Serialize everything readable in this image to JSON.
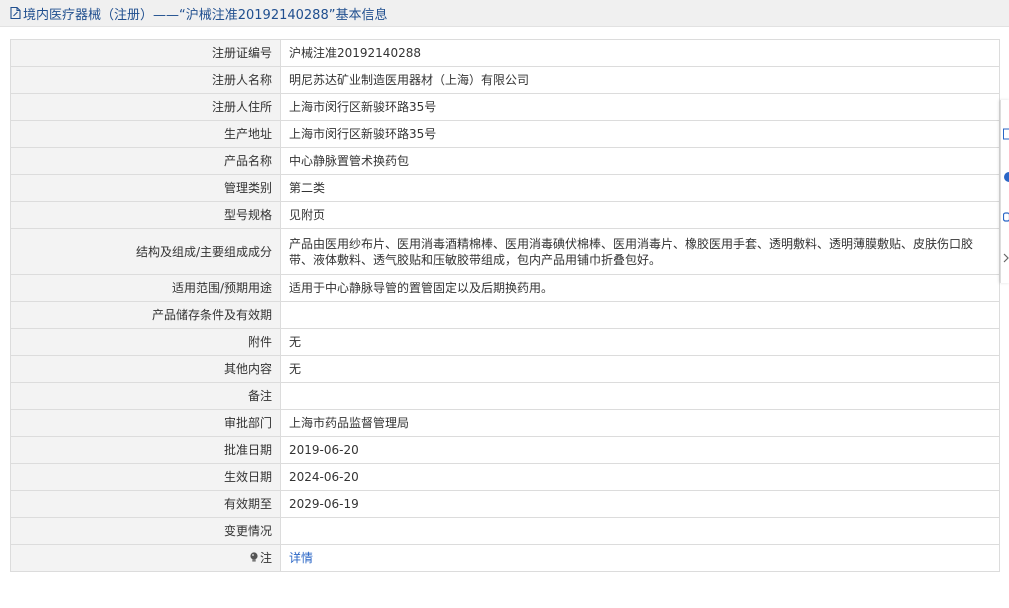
{
  "header": {
    "title": "境内医疗器械（注册）——“沪械注准20192140288”基本信息"
  },
  "rows": [
    {
      "label": "注册证编号",
      "value": "沪械注准20192140288"
    },
    {
      "label": "注册人名称",
      "value": "明尼苏达矿业制造医用器材（上海）有限公司"
    },
    {
      "label": "注册人住所",
      "value": "上海市闵行区新骏环路35号"
    },
    {
      "label": "生产地址",
      "value": "上海市闵行区新骏环路35号"
    },
    {
      "label": "产品名称",
      "value": "中心静脉置管术换药包"
    },
    {
      "label": "管理类别",
      "value": "第二类"
    },
    {
      "label": "型号规格",
      "value": "见附页"
    },
    {
      "label": "结构及组成/主要组成成分",
      "value": "产品由医用纱布片、医用消毒酒精棉棒、医用消毒碘伏棉棒、医用消毒片、橡胶医用手套、透明敷料、透明薄膜敷贴、皮肤伤口胶带、液体敷料、透气胶贴和压敏胶带组成，包内产品用铺巾折叠包好。"
    },
    {
      "label": "适用范围/预期用途",
      "value": "适用于中心静脉导管的置管固定以及后期换药用。"
    },
    {
      "label": "产品储存条件及有效期",
      "value": ""
    },
    {
      "label": "附件",
      "value": "无"
    },
    {
      "label": "其他内容",
      "value": "无"
    },
    {
      "label": "备注",
      "value": ""
    },
    {
      "label": "审批部门",
      "value": "上海市药品监督管理局"
    },
    {
      "label": "批准日期",
      "value": "2019-06-20"
    },
    {
      "label": "生效日期",
      "value": "2024-06-20"
    },
    {
      "label": "有效期至",
      "value": "2029-06-19"
    },
    {
      "label": "变更情况",
      "value": ""
    }
  ],
  "note_row": {
    "label": "注",
    "link": "详情"
  },
  "icons": {
    "title": "document-icon",
    "note": "lightbulb-icon",
    "side": [
      "copy-icon",
      "circle-icon",
      "share-icon",
      "chevron-right-icon"
    ]
  },
  "colors": {
    "title_text": "#204f8f",
    "label_bg": "#f3f3f3",
    "border": "#dcdcdc",
    "link": "#2a66c6"
  }
}
